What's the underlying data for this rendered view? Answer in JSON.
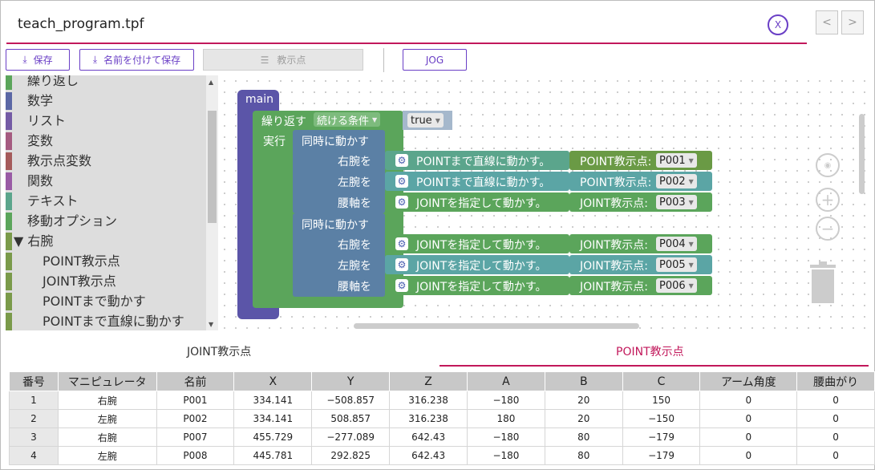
{
  "window": {
    "title": "teach_program.tpf",
    "close_label": "X",
    "prev_label": "<",
    "next_label": ">"
  },
  "toolbar": {
    "save_label": "保存",
    "save_as_label": "名前を付けて保存",
    "teach_point_label": "教示点",
    "jog_label": "JOG"
  },
  "sidebar": {
    "items": [
      {
        "label": "繰り返し",
        "color": "#5ba55b"
      },
      {
        "label": "数学",
        "color": "#5b67a5"
      },
      {
        "label": "リスト",
        "color": "#745ba5"
      },
      {
        "label": "変数",
        "color": "#a55b80"
      },
      {
        "label": "教示点変数",
        "color": "#a55b5b"
      },
      {
        "label": "関数",
        "color": "#995ba5"
      },
      {
        "label": "テキスト",
        "color": "#5ba58c"
      },
      {
        "label": "移動オプション",
        "color": "#5ba55b"
      },
      {
        "label": "▼ 右腕",
        "color": "#7a9a4a"
      },
      {
        "label": "POINT教示点",
        "color": "#7a9a4a"
      },
      {
        "label": "JOINT教示点",
        "color": "#7a9a4a"
      },
      {
        "label": "POINTまで動かす",
        "color": "#7a9a4a"
      },
      {
        "label": "POINTまで直線に動かす",
        "color": "#7a9a4a"
      }
    ]
  },
  "workspace": {
    "main_label": "main",
    "repeat_label": "繰り返す",
    "condition_label": "続ける条件",
    "true_label": "true",
    "do_label": "実行",
    "groups": [
      {
        "label": "同時に動かす",
        "rows": [
          {
            "arm": "右腕を",
            "action": "POINTまで直線に動かす。",
            "point_type": "POINT教示点:",
            "point": "P001"
          },
          {
            "arm": "左腕を",
            "action": "POINTまで直線に動かす。",
            "point_type": "POINT教示点:",
            "point": "P002"
          },
          {
            "arm": "腰軸を",
            "action": "JOINTを指定して動かす。",
            "point_type": "JOINT教示点:",
            "point": "P003"
          }
        ]
      },
      {
        "label": "同時に動かす",
        "rows": [
          {
            "arm": "右腕を",
            "action": "JOINTを指定して動かす。",
            "point_type": "JOINT教示点:",
            "point": "P004"
          },
          {
            "arm": "左腕を",
            "action": "JOINTを指定して動かす。",
            "point_type": "JOINT教示点:",
            "point": "P005"
          },
          {
            "arm": "腰軸を",
            "action": "JOINTを指定して動かす。",
            "point_type": "JOINT教示点:",
            "point": "P006"
          }
        ]
      }
    ],
    "zoom_in_label": "+",
    "zoom_out_label": "−"
  },
  "tabs": {
    "joint": "JOINT教示点",
    "point": "POINT教示点",
    "active": "point",
    "active_color": "#c2185b"
  },
  "table": {
    "headers": [
      "番号",
      "マニピュレータ",
      "名前",
      "X",
      "Y",
      "Z",
      "A",
      "B",
      "C",
      "アーム角度",
      "腰曲がり"
    ],
    "rows": [
      [
        "1",
        "右腕",
        "P001",
        "334.141",
        "−508.857",
        "316.238",
        "−180",
        "20",
        "150",
        "0",
        "0"
      ],
      [
        "2",
        "左腕",
        "P002",
        "334.141",
        "508.857",
        "316.238",
        "180",
        "20",
        "−150",
        "0",
        "0"
      ],
      [
        "3",
        "右腕",
        "P007",
        "455.729",
        "−277.089",
        "642.43",
        "−180",
        "80",
        "−179",
        "0",
        "0"
      ],
      [
        "4",
        "左腕",
        "P008",
        "445.781",
        "292.825",
        "642.43",
        "−180",
        "80",
        "−179",
        "0",
        "0"
      ]
    ]
  },
  "colors": {
    "accent": "#6a3fc6",
    "underline": "#c2185b",
    "main_block": "#5b55a8",
    "loop_block": "#5ba55b",
    "parallel_block": "#5b80a5",
    "point_move_block": "#5ba58c",
    "joint_move_block": "#5ba55b"
  }
}
